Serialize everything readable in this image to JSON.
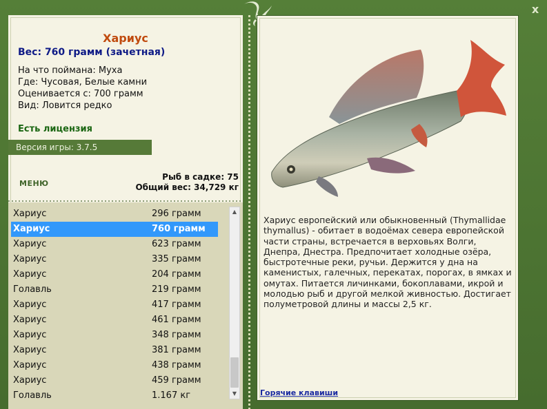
{
  "window": {
    "close_label": "x"
  },
  "catch": {
    "title": "Хариус",
    "weight": "Вес: 760 грамм (зачетная)",
    "bait": "На что поймана: Муха",
    "place": "Где: Чусовая, Белые камни",
    "valued": "Оценивается с: 700 грамм",
    "kind": "Вид: Ловится редко",
    "license": "Есть лицензия"
  },
  "version": "Версия игры: 3.7.5",
  "menu_label": "МЕНЮ",
  "totals": {
    "count": "Рыб в садке: 75",
    "weight": "Общий вес: 34,729 кг"
  },
  "fish_list": [
    {
      "name": "Хариус",
      "weight": "296 грамм"
    },
    {
      "name": "Хариус",
      "weight": "760 грамм",
      "selected": true
    },
    {
      "name": "Хариус",
      "weight": "623 грамм"
    },
    {
      "name": "Хариус",
      "weight": "335 грамм"
    },
    {
      "name": "Хариус",
      "weight": "204 грамм"
    },
    {
      "name": "Голавль",
      "weight": "219 грамм"
    },
    {
      "name": "Хариус",
      "weight": "417 грамм"
    },
    {
      "name": "Хариус",
      "weight": "461 грамм"
    },
    {
      "name": "Хариус",
      "weight": "348 грамм"
    },
    {
      "name": "Хариус",
      "weight": "381 грамм"
    },
    {
      "name": "Хариус",
      "weight": "438 грамм"
    },
    {
      "name": "Хариус",
      "weight": "459 грамм"
    },
    {
      "name": "Голавль",
      "weight": "1.167 кг"
    }
  ],
  "description": "Хариус европейский или обыкновенный (Thymallidae thymallus) - обитает в водоёмах севера европейской части страны, встречается в верховьях Волги, Днепра, Днестра. Предпочитает холодные озёра, быстротечные реки, ручьи. Держится у дна на каменистых, галечных, перекатах, порогах, в ямках и омутах. Питается личинками, бокоплавами, икрой и молодью рыб и другой мелкой живностью. Достигает полуметровой длины и массы 2,5 кг.",
  "hotkeys_label": "Горячие клавиши",
  "colors": {
    "accent_title": "#c04a0e",
    "weight_text": "#0e1a86",
    "license_text": "#1a6612",
    "selection": "#3298fb",
    "frame": "#4d7733"
  },
  "icons": {
    "logo": "lizard-logo-icon",
    "close": "close-icon",
    "fish": "grayling-fish-image"
  }
}
